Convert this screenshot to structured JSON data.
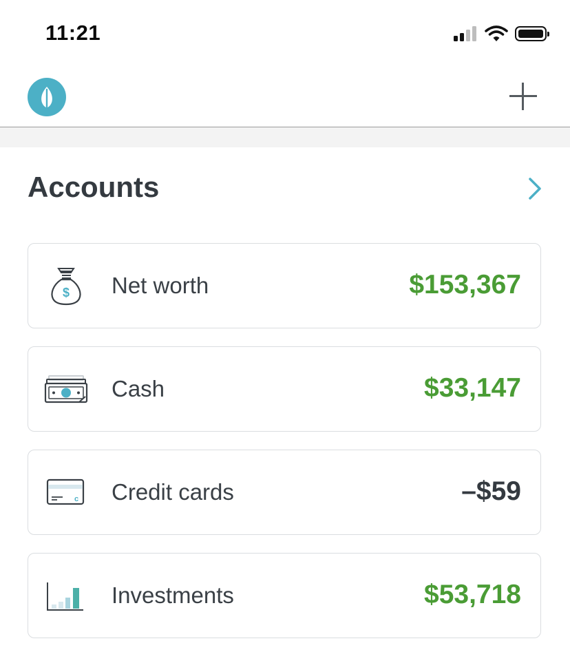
{
  "status_bar": {
    "time": "11:21"
  },
  "header": {
    "logo_icon": "leaf-icon",
    "add_icon": "plus-icon",
    "brand_color": "#4cb0c6"
  },
  "accounts": {
    "title": "Accounts",
    "chevron_icon": "chevron-right-icon",
    "items": [
      {
        "label": "Net worth",
        "value": "$153,367",
        "icon": "money-bag-icon",
        "positive": true
      },
      {
        "label": "Cash",
        "value": "$33,147",
        "icon": "cash-icon",
        "positive": true
      },
      {
        "label": "Credit cards",
        "value": "–$59",
        "icon": "credit-card-icon",
        "positive": false
      },
      {
        "label": "Investments",
        "value": "$53,718",
        "icon": "investments-chart-icon",
        "positive": true
      }
    ]
  },
  "colors": {
    "positive": "#4a9c35",
    "neutral": "#343a40",
    "accent": "#4cb0c6"
  }
}
